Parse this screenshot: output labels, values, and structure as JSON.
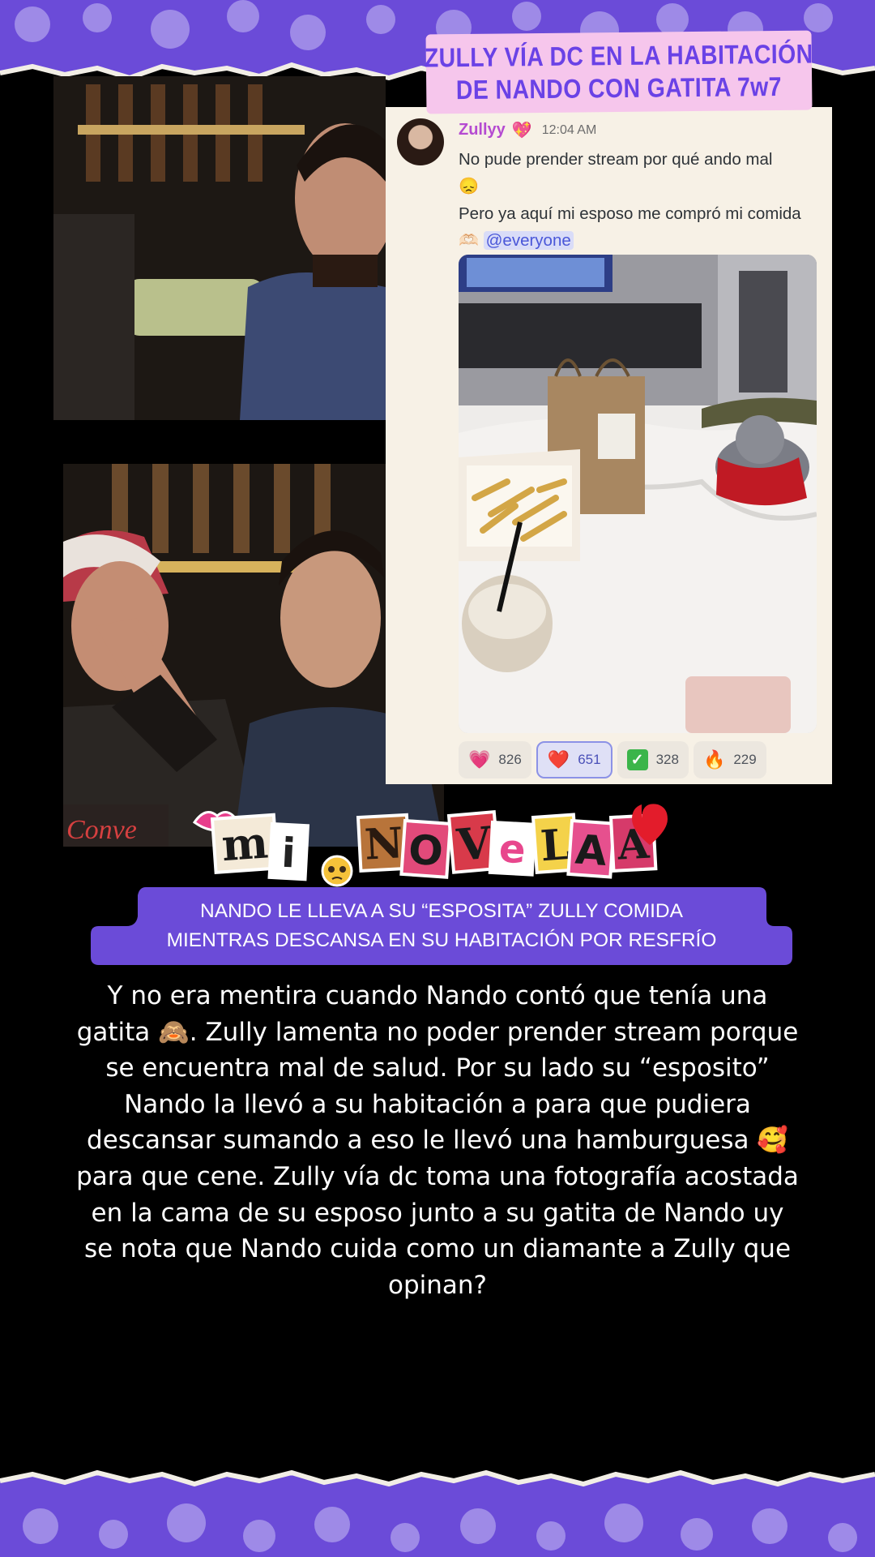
{
  "title": {
    "line1": "ZULLY VÍA DC EN LA HABITACIÓN",
    "line2": "DE NANDO CON GATITA 7w7"
  },
  "discord": {
    "username": "Zullyy",
    "name_badge": "💖",
    "time": "12:04 AM",
    "message_line1": "No pude prender stream por qué ando mal",
    "message_emoji": "😞",
    "message_line2": "Pero ya aquí mi esposo me compró mi comida",
    "message_hands": "🫶🏻",
    "mention": "@everyone",
    "reactions": [
      {
        "icon": "💗",
        "icon_name": "pink-heart-icon",
        "count": "826",
        "active": false
      },
      {
        "icon": "❤️",
        "icon_name": "red-heart-icon",
        "count": "651",
        "active": true
      },
      {
        "icon": "✓",
        "icon_name": "check-mark-icon",
        "count": "328",
        "active": false
      },
      {
        "icon": "🔥",
        "icon_name": "fire-icon",
        "count": "229",
        "active": false
      }
    ]
  },
  "logo": {
    "letters": [
      "m",
      "i",
      "N",
      "O",
      "V",
      "e",
      "L",
      "A",
      "A"
    ]
  },
  "headline": {
    "line1": "NANDO LE LLEVA A SU “ESPOSITA” ZULLY COMIDA",
    "line2": "MIENTRAS DESCANSA EN SU HABITACIÓN POR RESFRÍO"
  },
  "body": {
    "text": "Y no era mentira cuando Nando contó que tenía una gatita 🙈. Zully lamenta no poder prender stream porque se encuentra mal de salud. Por su lado su “esposito” Nando la llevó a su habitación a para que pudiera descansar sumando a eso le llevó una hamburguesa 🥰 para que cene. Zully vía dc toma una fotografía acostada en la cama de su esposo junto a su gatita de Nando uy se nota que Nando cuida como un diamante a Zully que opinan?"
  },
  "colors": {
    "banner_purple": "#6b4bd8",
    "title_bg": "#f6c6ec",
    "title_text": "#6a42e6",
    "headline_bg": "#6b4bd8",
    "discord_bg": "#f7f1e6",
    "name_color": "#b54bd1",
    "mention_color": "#4a57d8"
  }
}
